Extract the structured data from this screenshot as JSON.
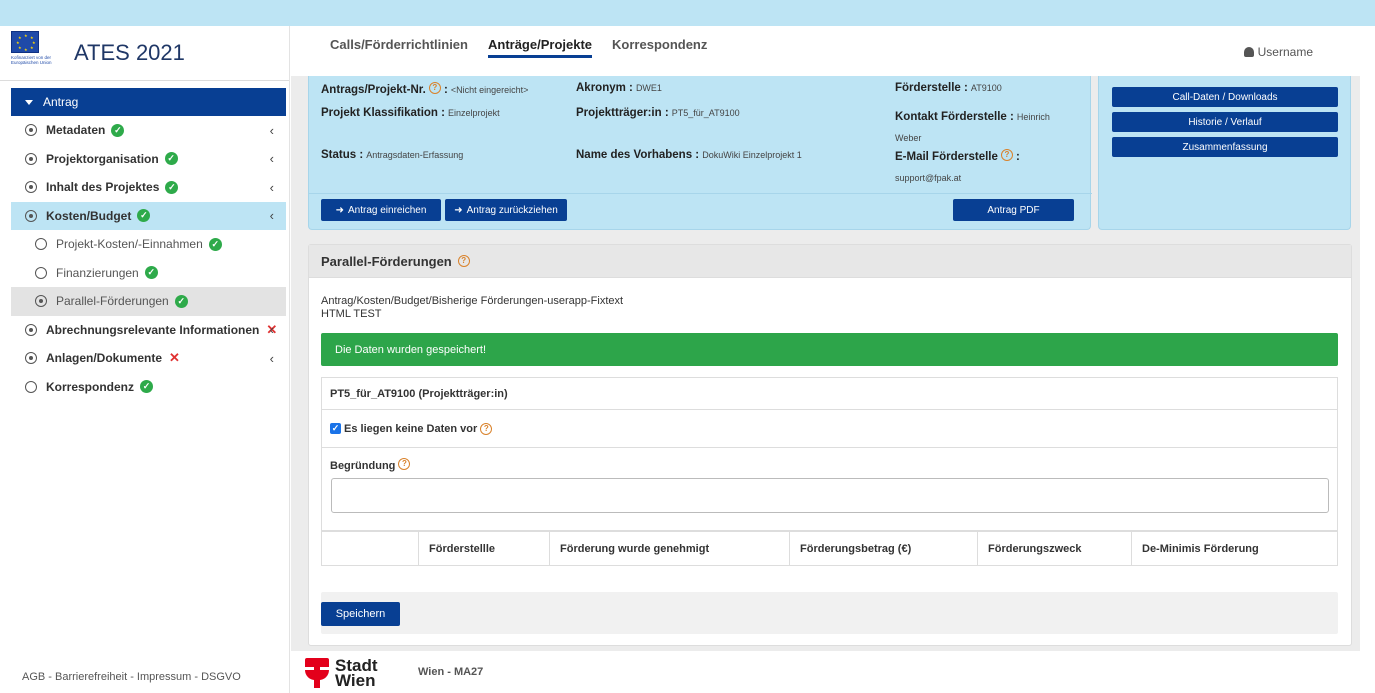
{
  "brand": {
    "title": "ATES 2021",
    "eu_caption": "Kofinanziert von der Europäischen Union"
  },
  "tabs": [
    {
      "label": "Calls/Förderrichtlinien"
    },
    {
      "label": "Anträge/Projekte"
    },
    {
      "label": "Korrespondenz"
    }
  ],
  "user": {
    "label": "Username"
  },
  "sidebar": {
    "items": [
      {
        "label": "Antrag"
      },
      {
        "label": "Metadaten"
      },
      {
        "label": "Projektorganisation"
      },
      {
        "label": "Inhalt des Projektes"
      },
      {
        "label": "Kosten/Budget"
      },
      {
        "label": "Projekt-Kosten/-Einnahmen"
      },
      {
        "label": "Finanzierungen"
      },
      {
        "label": "Parallel-Förderungen"
      },
      {
        "label": "Abrechnungsrelevante Informationen"
      },
      {
        "label": "Anlagen/Dokumente"
      },
      {
        "label": "Korrespondenz"
      }
    ],
    "footer": "AGB - Barrierefreiheit - Impressum - DSGVO"
  },
  "info": {
    "antrag_label": "Antrags/Projekt-Nr.",
    "antrag_value": "<Nicht eingereicht>",
    "akronym_label": "Akronym :",
    "akronym_value": "DWE1",
    "foerderstelle_label": "Förderstelle :",
    "foerderstelle_value": "AT9100",
    "klass_label": "Projekt Klassifikation :",
    "klass_value": "Einzelprojekt",
    "traeger_label": "Projektträger:in :",
    "traeger_value": "PT5_für_AT9100",
    "kontakt_label": "Kontakt Förderstelle :",
    "kontakt_value_1": "Heinrich",
    "kontakt_value_2": "Weber",
    "status_label": "Status :",
    "status_value": "Antragsdaten-Erfassung",
    "vorhaben_label": "Name des Vorhabens :",
    "vorhaben_value": "DokuWiki Einzelprojekt 1",
    "email_label": "E-Mail Förderstelle",
    "email_value": "support@fpak.at",
    "colon": ":",
    "btn_einreichen": "Antrag einreichen",
    "btn_zurueck": "Antrag zurückziehen",
    "btn_pdf": "Antrag PDF"
  },
  "side_buttons": [
    {
      "label": "Call-Daten / Downloads"
    },
    {
      "label": "Historie / Verlauf"
    },
    {
      "label": "Zusammenfassung"
    }
  ],
  "panel": {
    "title": "Parallel-Förderungen",
    "fixtext_1": "Antrag/Kosten/Budget/Bisherige Förderungen-userapp-Fixtext",
    "fixtext_2": "HTML TEST",
    "success": "Die Daten wurden gespeichert!",
    "traeger": "PT5_für_AT9100 (Projektträger:in)",
    "keine_daten": "Es liegen keine Daten vor",
    "begruendung": "Begründung",
    "columns": [
      "Förderstellle",
      "Förderung wurde genehmigt",
      "Förderungsbetrag (€)",
      "Förderungszweck",
      "De-Minimis Förderung"
    ],
    "save": "Speichern"
  },
  "footer": {
    "stadt_1": "Stadt",
    "stadt_2": "Wien",
    "ma27": "Wien - MA27"
  },
  "colors": {
    "primary": "#083f93",
    "light_blue": "#bde4f4",
    "success": "#2da54a",
    "error": "#e03131"
  }
}
